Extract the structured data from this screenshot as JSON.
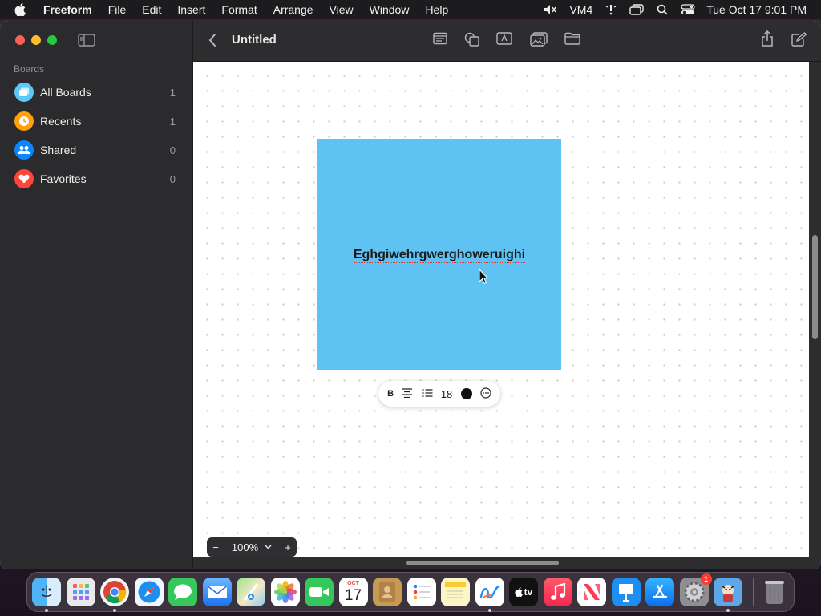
{
  "menubar": {
    "app_name": "Freeform",
    "items": [
      "File",
      "Edit",
      "Insert",
      "Format",
      "Arrange",
      "View",
      "Window",
      "Help"
    ],
    "status_label": "VM4",
    "clock": "Tue Oct 17  9:01 PM"
  },
  "sidebar": {
    "section_title": "Boards",
    "items": [
      {
        "label": "All Boards",
        "count": "1",
        "icon": "all-boards-icon",
        "color": "#5ac8fa"
      },
      {
        "label": "Recents",
        "count": "1",
        "icon": "clock-icon",
        "color": "#ff9f0a"
      },
      {
        "label": "Shared",
        "count": "0",
        "icon": "people-icon",
        "color": "#0a84ff"
      },
      {
        "label": "Favorites",
        "count": "0",
        "icon": "heart-icon",
        "color": "#ff453a"
      }
    ]
  },
  "toolbar": {
    "title": "Untitled"
  },
  "canvas": {
    "sticky_note_text": "Eghgiwehrgwerghoweruighi",
    "sticky_color": "#5ec3f2",
    "format_bar": {
      "bold": "B",
      "font_size": "18"
    }
  },
  "zoom": {
    "minus": "−",
    "value": "100%",
    "plus": "+"
  },
  "dock": {
    "calendar_month": "OCT",
    "calendar_day": "17",
    "settings_badge": "1",
    "tv_label": "tv"
  }
}
